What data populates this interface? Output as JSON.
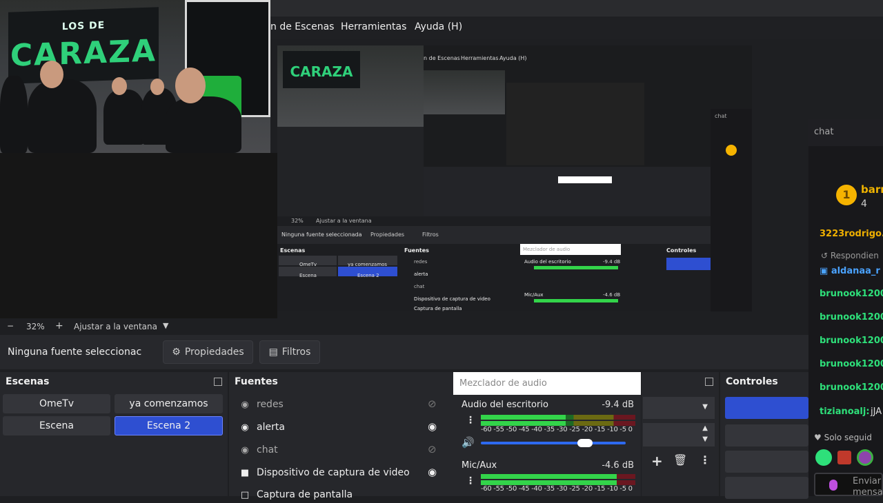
{
  "menu": {
    "items": [
      "n de Escenas",
      "Herramientas",
      "Ayuda (H)"
    ]
  },
  "webcam": {
    "banner_top": "LOS DE",
    "banner_main": "CARAZA"
  },
  "preview": {
    "menu": [
      "n de Escenas",
      "Herramientas",
      "Ayuda (H)"
    ],
    "chat_label": "chat",
    "lower": {
      "zoom": "32%",
      "fit": "Ajustar a la ventana",
      "no_source": "Ninguna fuente seleccionada",
      "properties": "Propiedades",
      "filters": "Filtros",
      "scenes": "Escenas",
      "sources": "Fuentes",
      "mixer": "Mezclador de audio",
      "controls": "Controles",
      "scene_items": [
        "OmeTv",
        "ya comenzamos",
        "Escena",
        "Escena 2"
      ],
      "source_items": [
        "redes",
        "alerta",
        "chat",
        "Dispositivo de captura de video",
        "Captura de pantalla"
      ],
      "channels": [
        {
          "name": "Audio del escritorio",
          "db": "-9.4 dB"
        },
        {
          "name": "Mic/Aux",
          "db": "-4.6 dB"
        }
      ]
    }
  },
  "chat": {
    "header": "chat",
    "badge_number": "1",
    "top_user": "barr",
    "top_count": "4",
    "partial_name": "3223rodrigo.",
    "reply_label": "Respondien",
    "reply_user": "aldanaa_r",
    "users": [
      "brunook1200",
      "brunook1200",
      "brunook1200",
      "brunook1200",
      "brunook1200"
    ],
    "last_user": "tizianoalj:",
    "last_text": "jJA",
    "followers_only": "Solo seguid",
    "send_text": "Enviar",
    "send_text2": "mensa"
  },
  "zoombar": {
    "minus": "−",
    "zoom": "32%",
    "plus": "+",
    "fit": "Ajustar a la ventana"
  },
  "props": {
    "no_source": "Ninguna fuente seleccionac",
    "properties": "Propiedades",
    "filters": "Filtros"
  },
  "scenes": {
    "title": "Escenas",
    "items": [
      {
        "label": "OmeTv",
        "active": false
      },
      {
        "label": "ya comenzamos",
        "active": false
      },
      {
        "label": "Escena",
        "active": false
      },
      {
        "label": "Escena 2",
        "active": true
      }
    ]
  },
  "sources": {
    "title": "Fuentes",
    "items": [
      {
        "label": "redes",
        "icon": "globe-icon",
        "visible": false
      },
      {
        "label": "alerta",
        "icon": "globe-icon",
        "visible": true
      },
      {
        "label": "chat",
        "icon": "globe-icon",
        "visible": false
      },
      {
        "label": "Dispositivo de captura de video",
        "icon": "camera-icon",
        "visible": true
      },
      {
        "label": "Captura de pantalla",
        "icon": "monitor-icon",
        "visible": true
      }
    ]
  },
  "mixer": {
    "title": "Mezclador de audio",
    "ticks": "-60 -55 -50 -45 -40 -35 -30 -25 -20 -15 -10 -5  0",
    "channels": [
      {
        "name": "Audio del escritorio",
        "db": "-9.4 dB",
        "level": 0.55,
        "volume": 0.72
      },
      {
        "name": "Mic/Aux",
        "db": "-4.6 dB",
        "level": 0.88
      }
    ]
  },
  "controls": {
    "title": "Controles"
  },
  "colors": {
    "accent": "#2e4fd1",
    "chat_user": "#2ee07a",
    "meter_green": "#33d44a"
  }
}
